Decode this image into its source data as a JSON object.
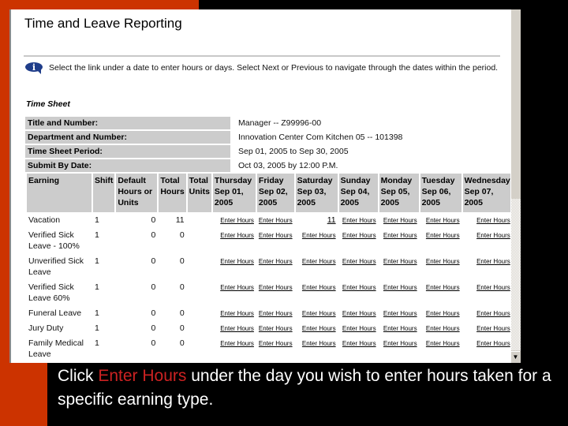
{
  "page": {
    "title": "Time and Leave Reporting",
    "info_icon": "info-speech-bubble-icon",
    "info_text": "Select the link under a date to enter hours or days. Select Next or Previous to navigate through the dates within the period.",
    "section_title": "Time Sheet"
  },
  "timesheet_info": [
    {
      "label": "Title and Number:",
      "value": "Manager -- Z99996-00"
    },
    {
      "label": "Department and Number:",
      "value": "Innovation Center Com Kitchen 05 -- 101398"
    },
    {
      "label": "Time Sheet Period:",
      "value": "Sep 01, 2005 to Sep 30, 2005"
    },
    {
      "label": "Submit By Date:",
      "value": "Oct 03, 2005 by 12:00 P.M."
    }
  ],
  "grid": {
    "headers": {
      "earning": "Earning",
      "shift": "Shift",
      "default": "Default Hours or Units",
      "total_hours": "Total Hours",
      "total_units": "Total Units",
      "days": [
        {
          "day": "Thursday",
          "date": "Sep 01,",
          "year": "2005"
        },
        {
          "day": "Friday",
          "date": "Sep 02,",
          "year": "2005"
        },
        {
          "day": "Saturday",
          "date": "Sep 03,",
          "year": "2005"
        },
        {
          "day": "Sunday",
          "date": "Sep 04,",
          "year": "2005"
        },
        {
          "day": "Monday",
          "date": "Sep 05,",
          "year": "2005"
        },
        {
          "day": "Tuesday",
          "date": "Sep 06,",
          "year": "2005"
        },
        {
          "day": "Wednesday",
          "date": "Sep 07,",
          "year": "2005"
        }
      ]
    },
    "link_label": "Enter Hours",
    "rows": [
      {
        "earning": "Vacation",
        "shift": "1",
        "default": "0",
        "total_hours": "11",
        "total_units": "",
        "days": [
          "Enter Hours",
          "Enter Hours",
          "11",
          "Enter Hours",
          "Enter Hours",
          "Enter Hours",
          "Enter Hours"
        ]
      },
      {
        "earning": "Verified Sick Leave - 100%",
        "shift": "1",
        "default": "0",
        "total_hours": "0",
        "total_units": "",
        "days": [
          "Enter Hours",
          "Enter Hours",
          "Enter Hours",
          "Enter Hours",
          "Enter Hours",
          "Enter Hours",
          "Enter Hours"
        ]
      },
      {
        "earning": "Unverified Sick Leave",
        "shift": "1",
        "default": "0",
        "total_hours": "0",
        "total_units": "",
        "days": [
          "Enter Hours",
          "Enter Hours",
          "Enter Hours",
          "Enter Hours",
          "Enter Hours",
          "Enter Hours",
          "Enter Hours"
        ]
      },
      {
        "earning": "Verified Sick Leave 60%",
        "shift": "1",
        "default": "0",
        "total_hours": "0",
        "total_units": "",
        "days": [
          "Enter Hours",
          "Enter Hours",
          "Enter Hours",
          "Enter Hours",
          "Enter Hours",
          "Enter Hours",
          "Enter Hours"
        ]
      },
      {
        "earning": "Funeral Leave",
        "shift": "1",
        "default": "0",
        "total_hours": "0",
        "total_units": "",
        "days": [
          "Enter Hours",
          "Enter Hours",
          "Enter Hours",
          "Enter Hours",
          "Enter Hours",
          "Enter Hours",
          "Enter Hours"
        ]
      },
      {
        "earning": "Jury Duty",
        "shift": "1",
        "default": "0",
        "total_hours": "0",
        "total_units": "",
        "days": [
          "Enter Hours",
          "Enter Hours",
          "Enter Hours",
          "Enter Hours",
          "Enter Hours",
          "Enter Hours",
          "Enter Hours"
        ]
      },
      {
        "earning": "Family Medical Leave",
        "shift": "1",
        "default": "0",
        "total_hours": "0",
        "total_units": "",
        "days": [
          "Enter Hours",
          "Enter Hours",
          "Enter Hours",
          "Enter Hours",
          "Enter Hours",
          "Enter Hours",
          "Enter Hours"
        ]
      }
    ]
  },
  "scrollbar": {
    "down_arrow_icon": "scroll-down-arrow-icon"
  },
  "caption": {
    "before": "Click ",
    "highlight": "Enter Hours",
    "after": " under the day you wish to enter hours taken for a specific earning type.",
    "highlight_color": "#cc2222"
  }
}
